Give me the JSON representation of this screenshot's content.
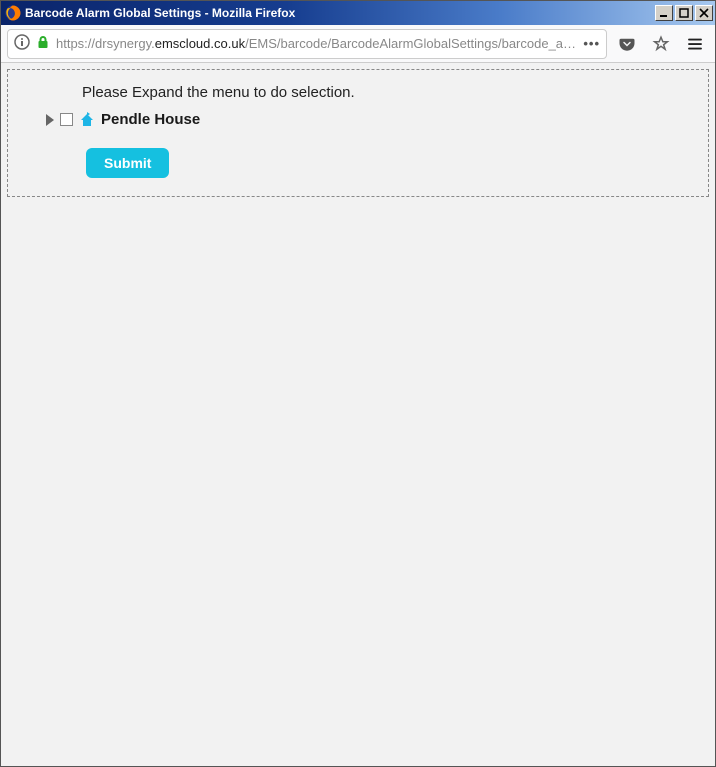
{
  "window": {
    "title": "Barcode Alarm Global Settings - Mozilla Firefox"
  },
  "url": {
    "prefix": "https://drsynergy.",
    "host": "emscloud.co.uk",
    "path": "/EMS/barcode/BarcodeAlarmGlobalSettings/barcode_alar"
  },
  "page": {
    "instruction": "Please Expand the menu to do selection.",
    "tree": {
      "root_label": "Pendle House"
    },
    "submit_label": "Submit"
  }
}
